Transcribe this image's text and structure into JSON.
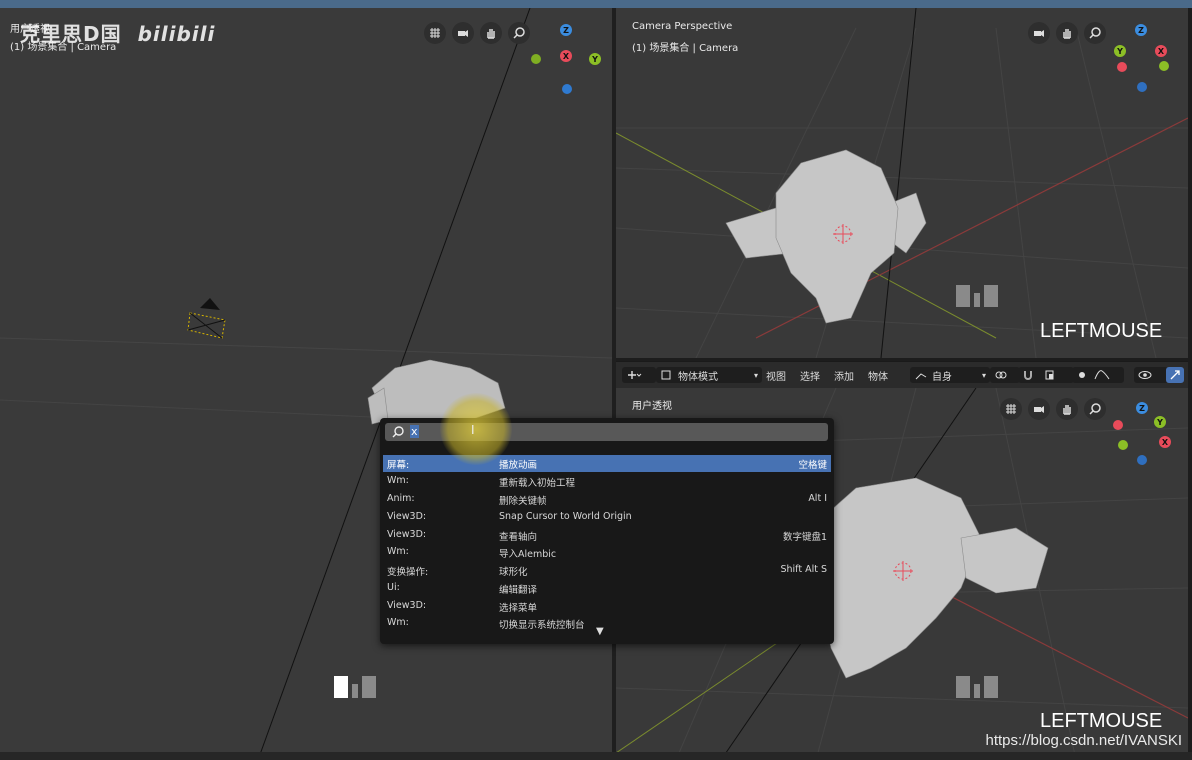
{
  "left_viewport": {
    "view_name": "用户透视",
    "collection_label": "(1) 场景集合 | Camera"
  },
  "top_right_viewport": {
    "view_name": "Camera Perspective",
    "collection_label": "(1) 场景集合 | Camera",
    "key_overlay": "LEFTMOUSE"
  },
  "bottom_right_viewport": {
    "view_name": "用户透视",
    "key_overlay": "LEFTMOUSE"
  },
  "gizmo_axes": {
    "x": "X",
    "y": "Y",
    "z": "Z"
  },
  "header_toolbar": {
    "mode": "物体模式",
    "menus": [
      "视图",
      "选择",
      "添加",
      "物体"
    ],
    "transform_orientation": "自身"
  },
  "search_popup": {
    "query": "x",
    "results": [
      {
        "category": "屏幕:",
        "name": "播放动画",
        "shortcut": "空格键"
      },
      {
        "category": "Wm:",
        "name": "重新载入初始工程",
        "shortcut": ""
      },
      {
        "category": "Anim:",
        "name": "删除关键帧",
        "shortcut": "Alt I"
      },
      {
        "category": "View3D:",
        "name": "Snap Cursor to World Origin",
        "shortcut": ""
      },
      {
        "category": "View3D:",
        "name": "查看轴向",
        "shortcut": "数字键盘1"
      },
      {
        "category": "Wm:",
        "name": "导入Alembic",
        "shortcut": ""
      },
      {
        "category": "变换操作:",
        "name": "球形化",
        "shortcut": "Shift Alt S"
      },
      {
        "category": "Ui:",
        "name": "编辑翻译",
        "shortcut": ""
      },
      {
        "category": "View3D:",
        "name": "选择菜单",
        "shortcut": ""
      },
      {
        "category": "Wm:",
        "name": "切换显示系统控制台",
        "shortcut": ""
      }
    ]
  },
  "watermarks": {
    "channel": "克里思D国",
    "site_logo": "bilibili",
    "url": "https://blog.csdn.net/IVANSKI"
  },
  "colors": {
    "selected_row": "#4772b3",
    "axis_x": "#e84b5a",
    "axis_y": "#8cbf26",
    "axis_z": "#3b8de0"
  }
}
